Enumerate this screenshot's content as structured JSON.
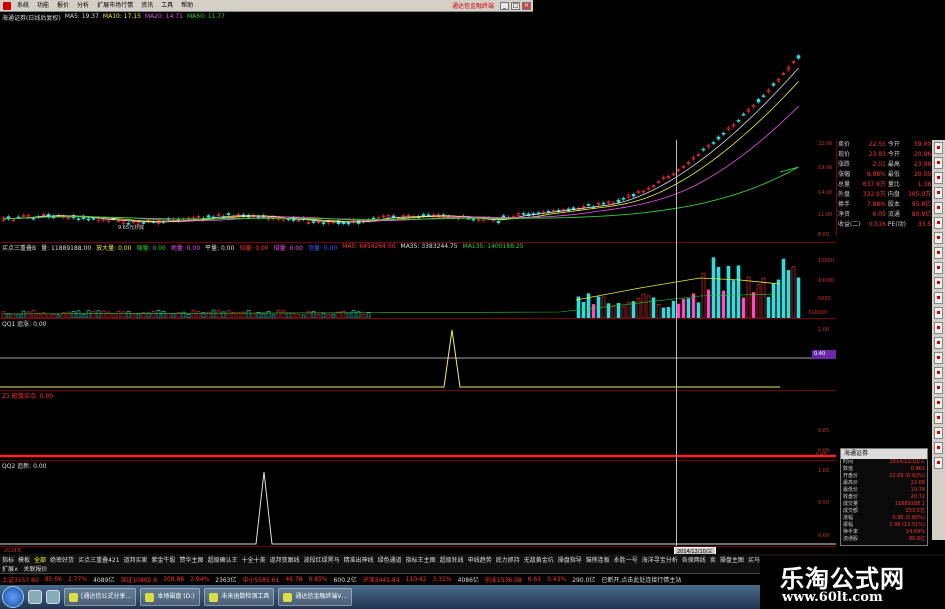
{
  "menubar": {
    "items": [
      "系统",
      "功能",
      "报价",
      "分析",
      "扩展市场行情",
      "资讯",
      "工具",
      "帮助"
    ],
    "broker": "通达信金融终端"
  },
  "main_legend": {
    "title": "海通证券(日线后复权)",
    "items": [
      {
        "text": "MA5: 19.37",
        "color": "#dddddd"
      },
      {
        "text": "MA10: 17.15",
        "color": "#eeee33"
      },
      {
        "text": "MA20: 14.71",
        "color": "#ee55ee"
      },
      {
        "text": "MA60: 11.77",
        "color": "#33cc33"
      }
    ]
  },
  "main_chart": {
    "annotation": "9.65元抄底",
    "axis": [
      "22.00",
      "19.00",
      "14.00",
      "11.00",
      "8.00"
    ]
  },
  "quote": {
    "rows": [
      [
        "卖价",
        "22.55",
        "今开",
        "59.00"
      ],
      [
        "现价",
        "23.83",
        "今开",
        "20.96"
      ],
      [
        "涨跌",
        "2.01",
        "最高",
        "23.98"
      ],
      [
        "涨幅",
        "9.98%",
        "最低",
        "20.50"
      ],
      [
        "总量",
        "637.9万",
        "量比",
        "1.38"
      ],
      [
        "外盘",
        "332.9万",
        "内盘",
        "305.0万"
      ],
      [
        "换手",
        "7.88%",
        "股本",
        "95.8亿"
      ],
      [
        "净资",
        "6.05",
        "流通",
        "80.9亿"
      ],
      [
        "收益(二)",
        "0.516",
        "PE(动)",
        "33.5"
      ]
    ]
  },
  "volume_pane": {
    "header": [
      {
        "text": "买点三重叠B",
        "color": "#dddddd"
      },
      {
        "text": "量: 11889188.00",
        "color": "#dddddd"
      },
      {
        "text": "放大量: 0.00",
        "color": "#eeee33"
      },
      {
        "text": "缩量: 0.00",
        "color": "#33cc33"
      },
      {
        "text": "地量: 0.00",
        "color": "#ee55ee"
      },
      {
        "text": "平量: 0.00",
        "color": "#dddddd"
      },
      {
        "text": "倍量: 0.00",
        "color": "#ff3333"
      },
      {
        "text": "倍量: 0.00",
        "color": "#ee55ee"
      },
      {
        "text": "顶量: 0.00",
        "color": "#3366ff"
      },
      {
        "text": "MA5: 6454264.00",
        "color": "#ff3333"
      },
      {
        "text": "MA35: 3383244.75",
        "color": "#dddddd"
      },
      {
        "text": "MA135: 1400188.25",
        "color": "#33cc33"
      }
    ],
    "axis": [
      "15000",
      "10000",
      "5000",
      "X10000"
    ]
  },
  "pane_q1": {
    "header": "QQ1 追涨: 0.00",
    "axis": [
      "1.00",
      "0.40"
    ],
    "level_badge": "0.40"
  },
  "pane_z1": {
    "header": "Z1  砸盘买点: 0.00",
    "axis": [
      "0.65",
      "0.00",
      "-0.45"
    ]
  },
  "pane_q2": {
    "header": "QQ2 追新: 0.00",
    "axis": [
      "1.00",
      "0.50",
      "0.00"
    ]
  },
  "chart_data": [
    {
      "type": "line",
      "title": "QQ1 追涨",
      "x": [
        "2014/12/10"
      ],
      "series": [
        {
          "name": "追涨",
          "values": [
            1.0
          ]
        }
      ],
      "ylim": [
        0,
        1
      ]
    },
    {
      "type": "line",
      "title": "QQ2 追新",
      "x": [
        "2014/12/10"
      ],
      "series": [
        {
          "name": "追新",
          "values": [
            1.0
          ]
        }
      ],
      "ylim": [
        0,
        1
      ]
    }
  ],
  "infobox": {
    "title": "海通证券",
    "rows": [
      [
        "时间",
        "2014/12/10/三"
      ],
      [
        "数值",
        "0.461"
      ],
      [
        "开盘价",
        "22.09 (0.92%)"
      ],
      [
        "最高价",
        "22.66"
      ],
      [
        "最低价",
        "19.74"
      ],
      [
        "收盘价",
        "20.72"
      ],
      [
        "成交量",
        "11889188.1"
      ],
      [
        "成交额",
        "253.5亿"
      ],
      [
        "涨幅",
        "0.95 (5.80%)"
      ],
      [
        "振幅",
        "2.96 (13.51%)"
      ],
      [
        "换手率",
        "14.69%"
      ],
      [
        "流通股",
        "80.9亿"
      ]
    ]
  },
  "datebar": {
    "left_label": "2014年",
    "current": "2014/12/10/三"
  },
  "tabs": [
    "指标",
    "模板",
    "全部",
    "绝密好货",
    "买点三重叠421",
    "道邦买家",
    "紫金牛股",
    "赞华主图",
    "超级确认王",
    "十全十美",
    "道邦变跟线",
    "波段红绿黑马",
    "精准出神线",
    "绿色通道",
    "指标王主图",
    "超级狂线",
    "申线趋势",
    "底力抓持",
    "无敌黄金坑",
    "操盘指导",
    "猫熊连板",
    "永胜一号",
    "海洋寻宝分析",
    "各保两线",
    "卖",
    "操盘主图",
    "买马余跌",
    "之"
  ],
  "active_tab_index": 2,
  "subtabs": [
    "扩展∧",
    "关联报价"
  ],
  "statusbar": [
    {
      "text": "上证3157.60",
      "color": "#ff3333"
    },
    {
      "text": "85.06",
      "color": "#ff3333"
    },
    {
      "text": "2.77%",
      "color": "#ff3333"
    },
    {
      "text": "4089亿",
      "color": "#dddddd"
    },
    {
      "text": "深证10802.6",
      "color": "#ff3333"
    },
    {
      "text": "308.86",
      "color": "#ff3333"
    },
    {
      "text": "2.94%",
      "color": "#ff3333"
    },
    {
      "text": "2363亿",
      "color": "#dddddd"
    },
    {
      "text": "中小5585.61",
      "color": "#ff3333"
    },
    {
      "text": "46.78",
      "color": "#ff3333"
    },
    {
      "text": "0.85%",
      "color": "#ff3333"
    },
    {
      "text": "600.2亿",
      "color": "#dddddd"
    },
    {
      "text": "沪深3445.84",
      "color": "#ff3333"
    },
    {
      "text": "110.42",
      "color": "#ff3333"
    },
    {
      "text": "3.31%",
      "color": "#ff3333"
    },
    {
      "text": "4086亿",
      "color": "#dddddd"
    },
    {
      "text": "创业1536.08",
      "color": "#ff3333"
    },
    {
      "text": "6.61",
      "color": "#ff3333"
    },
    {
      "text": "0.43%",
      "color": "#ff3333"
    },
    {
      "text": "290.0亿",
      "color": "#dddddd"
    },
    {
      "text": "已断开,点击此处连接行情主站",
      "color": "#dddddd"
    }
  ],
  "taskbar": [
    "[通达信公式分享…",
    "本地磁盘 (D:)",
    "未来函数检测工具",
    "通达信金融终端V…"
  ],
  "watermark": {
    "cn": "乐淘公式网",
    "url": "www.60lt.com"
  },
  "colors": {
    "up": "#ff3333",
    "down": "#33cc33",
    "ma5": "#dddddd",
    "ma10": "#eeee33",
    "ma20": "#ee55ee",
    "ma60": "#33cc33",
    "bg": "#000000",
    "sep": "#7a0000"
  }
}
